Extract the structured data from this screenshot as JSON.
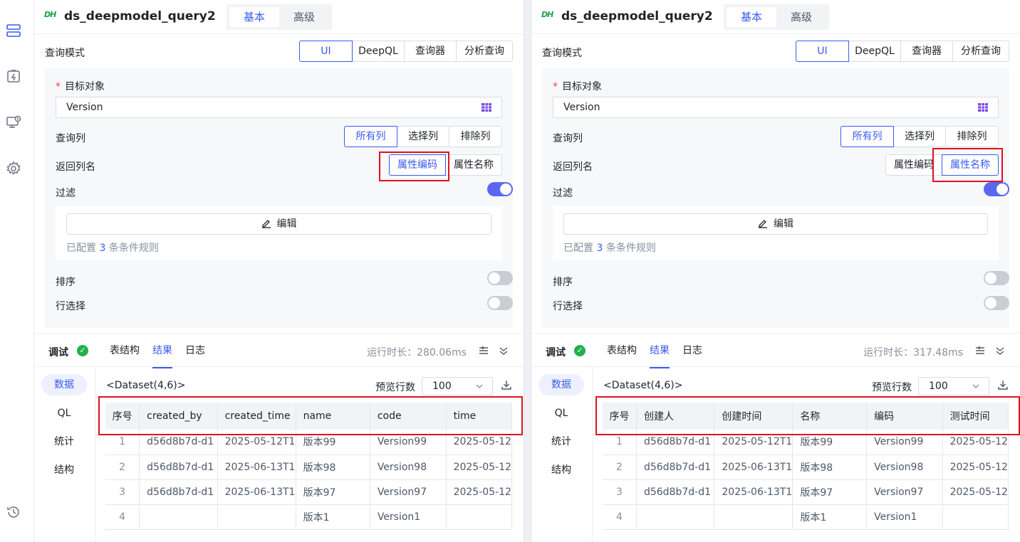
{
  "left_sidebar": {
    "icons": [
      "database-layers-icon",
      "flash-card-icon",
      "monitor-clock-icon",
      "gear-icon",
      "history-icon"
    ]
  },
  "panels": [
    {
      "logo": "DH",
      "title": "ds_deepmodel_query2",
      "mode_tabs": [
        "基本",
        "高级"
      ],
      "active_mode_tab": "基本",
      "query_mode": {
        "label": "查询模式",
        "options": [
          "UI",
          "DeepQL",
          "查询器",
          "分析查询"
        ],
        "active": "UI"
      },
      "target": {
        "label": "目标对象",
        "value": "Version"
      },
      "query_columns": {
        "label": "查询列",
        "options": [
          "所有列",
          "选择列",
          "排除列"
        ],
        "active": "所有列"
      },
      "return_column_name": {
        "label": "返回列名",
        "options": [
          "属性编码",
          "属性名称"
        ],
        "active": "属性编码"
      },
      "filter": {
        "label": "过滤",
        "enabled": true,
        "edit_label": "编辑",
        "note_prefix": "已配置",
        "count": "3",
        "note_suffix": "条条件规则"
      },
      "sort": {
        "label": "排序",
        "enabled": false
      },
      "row_select": {
        "label": "行选择",
        "enabled": false
      },
      "debug": {
        "title": "调试",
        "tabs": [
          "表结构",
          "结果",
          "日志"
        ],
        "active_tab": "结果",
        "runtime": "运行时长：280.06ms"
      },
      "side_tabs": [
        "数据",
        "QL",
        "统计",
        "结构"
      ],
      "active_side_tab": "数据",
      "dataset_label": "<Dataset(4,6)>",
      "preview_label": "预览行数",
      "preview_rows": "100",
      "table": {
        "columns": [
          "序号",
          "created_by",
          "created_time",
          "name",
          "code",
          "time"
        ],
        "rows": [
          [
            "1",
            "d56d8b7d-d1",
            "2025-05-12T1",
            "版本99",
            "Version99",
            "2025-05-12"
          ],
          [
            "2",
            "d56d8b7d-d1",
            "2025-06-13T1",
            "版本98",
            "Version98",
            "2025-05-12"
          ],
          [
            "3",
            "d56d8b7d-d1",
            "2025-06-13T1",
            "版本97",
            "Version97",
            "2025-05-12"
          ],
          [
            "4",
            "",
            "",
            "版本1",
            "Version1",
            ""
          ]
        ]
      }
    },
    {
      "logo": "DH",
      "title": "ds_deepmodel_query2",
      "mode_tabs": [
        "基本",
        "高级"
      ],
      "active_mode_tab": "基本",
      "query_mode": {
        "label": "查询模式",
        "options": [
          "UI",
          "DeepQL",
          "查询器",
          "分析查询"
        ],
        "active": "UI"
      },
      "target": {
        "label": "目标对象",
        "value": "Version"
      },
      "query_columns": {
        "label": "查询列",
        "options": [
          "所有列",
          "选择列",
          "排除列"
        ],
        "active": "所有列"
      },
      "return_column_name": {
        "label": "返回列名",
        "options": [
          "属性编码",
          "属性名称"
        ],
        "active": "属性名称"
      },
      "filter": {
        "label": "过滤",
        "enabled": true,
        "edit_label": "编辑",
        "note_prefix": "已配置",
        "count": "3",
        "note_suffix": "条条件规则"
      },
      "sort": {
        "label": "排序",
        "enabled": false
      },
      "row_select": {
        "label": "行选择",
        "enabled": false
      },
      "debug": {
        "title": "调试",
        "tabs": [
          "表结构",
          "结果",
          "日志"
        ],
        "active_tab": "结果",
        "runtime": "运行时长：317.48ms"
      },
      "side_tabs": [
        "数据",
        "QL",
        "统计",
        "结构"
      ],
      "active_side_tab": "数据",
      "dataset_label": "<Dataset(4,6)>",
      "preview_label": "预览行数",
      "preview_rows": "100",
      "table": {
        "columns": [
          "序号",
          "创建人",
          "创建时间",
          "名称",
          "编码",
          "测试时间"
        ],
        "rows": [
          [
            "1",
            "d56d8b7d-d1",
            "2025-05-12T1",
            "版本99",
            "Version99",
            "2025-05-12"
          ],
          [
            "2",
            "d56d8b7d-d1",
            "2025-06-13T1",
            "版本98",
            "Version98",
            "2025-05-12"
          ],
          [
            "3",
            "d56d8b7d-d1",
            "2025-06-13T1",
            "版本97",
            "Version97",
            "2025-05-12"
          ],
          [
            "4",
            "",
            "",
            "版本1",
            "Version1",
            ""
          ]
        ]
      }
    }
  ],
  "colors": {
    "accent": "#3a5bf0",
    "highlight_box": "#e0111f",
    "success": "#22b04a"
  }
}
